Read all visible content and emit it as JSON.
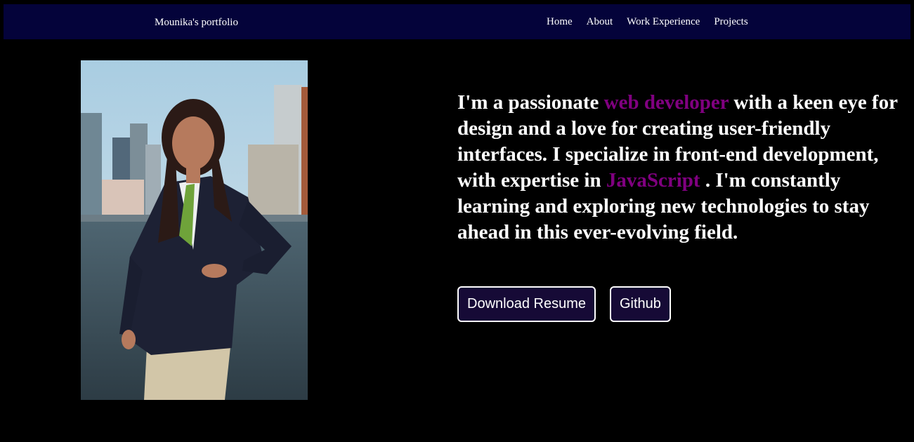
{
  "navbar": {
    "brand": "Mounika's portfolio",
    "links": [
      "Home",
      "About",
      "Work Experience",
      "Projects"
    ]
  },
  "hero": {
    "photo_icon": "profile-photo",
    "intro": {
      "part1": "I'm a passionate ",
      "highlight1": "web developer",
      "part2": " with a keen eye for design and a love for creating user-friendly interfaces. I specialize in front-end development, with expertise in ",
      "highlight2": "JavaScript",
      "part3": " . I'm constantly learning and exploring new technologies to stay ahead in this ever-evolving field."
    },
    "buttons": {
      "resume": "Download Resume",
      "github": "Github"
    }
  },
  "colors": {
    "background": "#000000",
    "navbar": "#04033a",
    "highlight": "#800080",
    "button_bg": "#160a36",
    "text": "#ffffff"
  }
}
